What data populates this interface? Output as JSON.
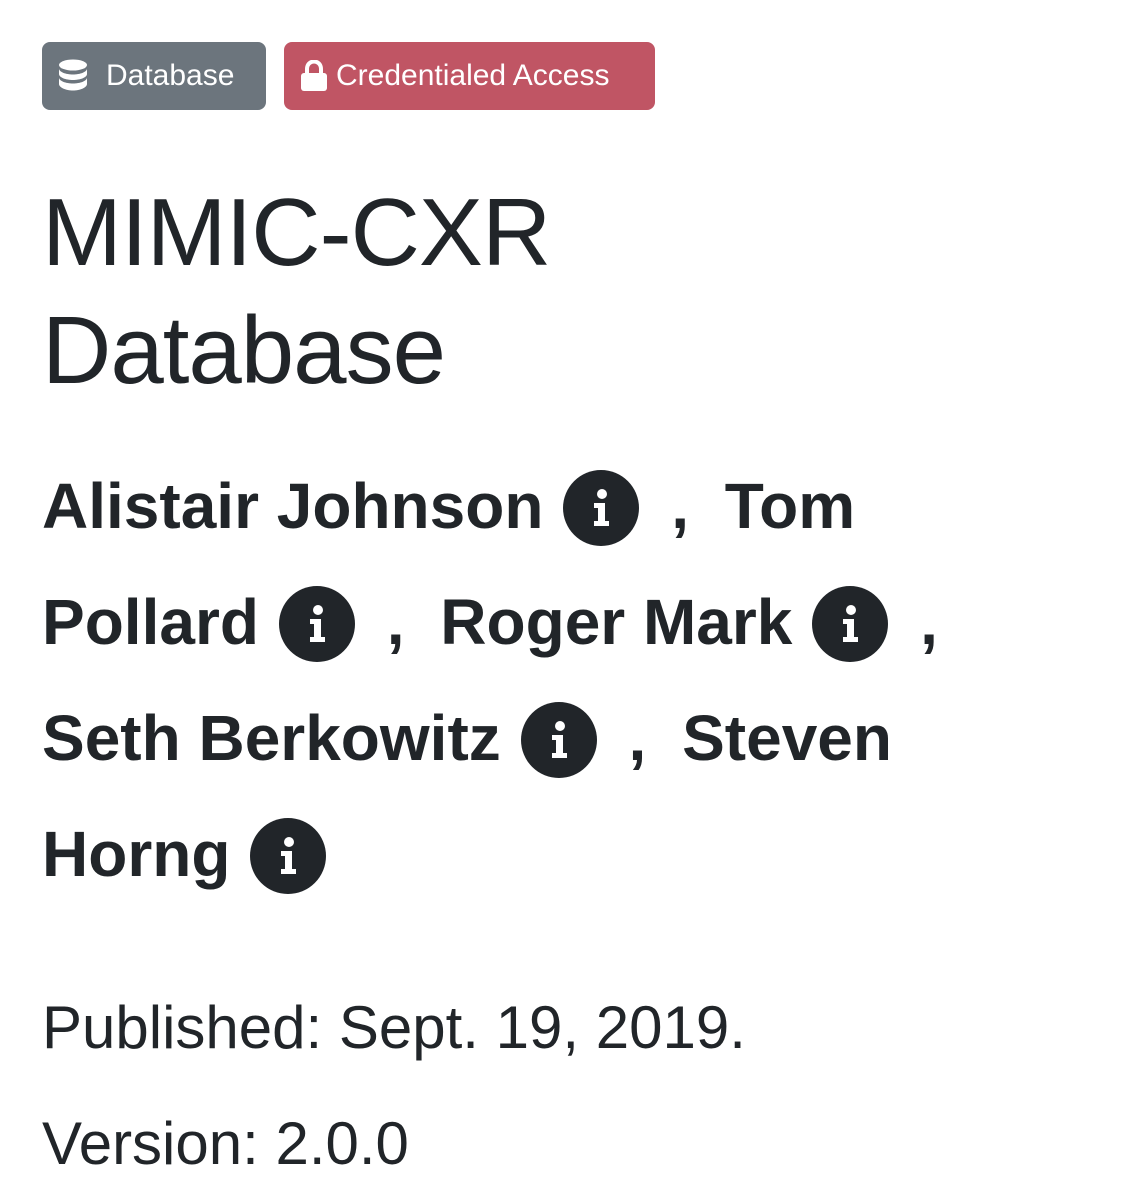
{
  "badges": {
    "type_label": "Database",
    "type_icon": "database-icon",
    "access_label": "Credentialed Access",
    "access_icon": "lock-icon",
    "type_color": "#6c757d",
    "access_color": "#c05564"
  },
  "project": {
    "title_line1": "MIMIC-CXR",
    "title_line2": "Database"
  },
  "authors": [
    {
      "name": "Alistair Johnson",
      "icon": "info-icon"
    },
    {
      "name": "Tom Pollard",
      "icon": "info-icon"
    },
    {
      "name": "Roger Mark",
      "icon": "info-icon"
    },
    {
      "name": "Seth Berkowitz",
      "icon": "info-icon"
    },
    {
      "name": "Steven Horng",
      "icon": "info-icon"
    }
  ],
  "author_name_parts": {
    "a1": "Alistair Johnson",
    "a2_first": "Tom",
    "a2_last": "Pollard",
    "a3": "Roger Mark",
    "a4": "Seth Berkowitz",
    "a5_first": "Steven",
    "a5_last": "Horng"
  },
  "separator": ",",
  "meta": {
    "published": "Published: Sept. 19, 2019.",
    "version": "Version: 2.0.0"
  }
}
